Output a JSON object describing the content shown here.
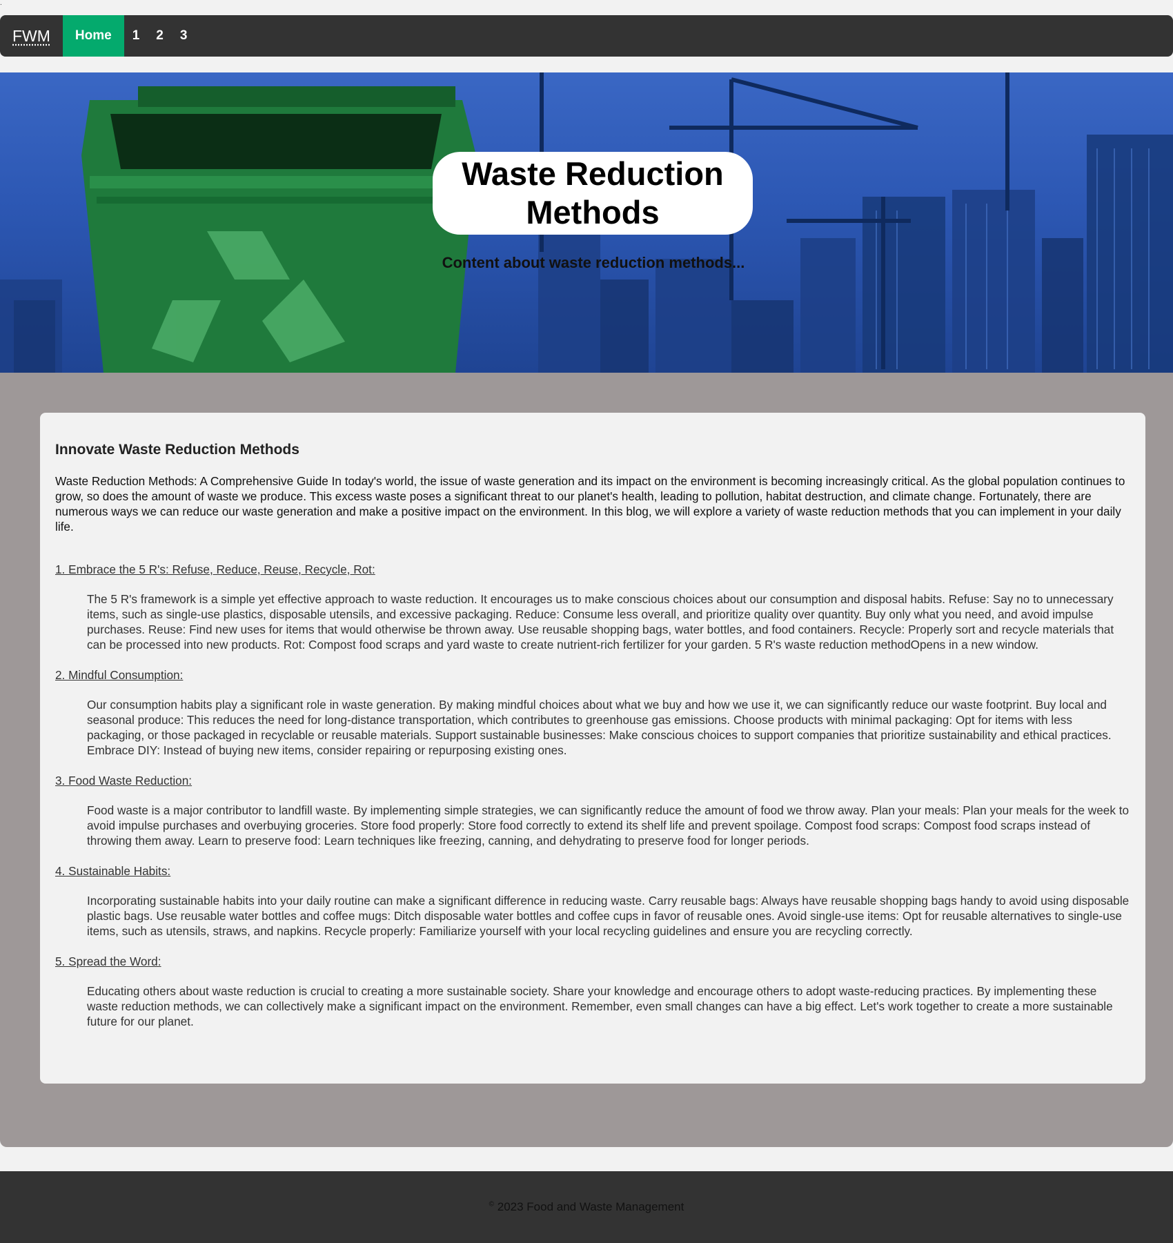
{
  "nav": {
    "brand": "FWM",
    "items": [
      "Home",
      "1",
      "2",
      "3"
    ]
  },
  "hero": {
    "title_line1": "Waste Reduction",
    "title_line2": "Methods",
    "subtitle": "Content about waste reduction methods..."
  },
  "article": {
    "heading": "Innovate Waste Reduction Methods",
    "intro": "Waste Reduction Methods: A Comprehensive Guide In today's world, the issue of waste generation and its impact on the environment is becoming increasingly critical. As the global population continues to grow, so does the amount of waste we produce. This excess waste poses a significant threat to our planet's health, leading to pollution, habitat destruction, and climate change. Fortunately, there are numerous ways we can reduce our waste generation and make a positive impact on the environment. In this blog, we will explore a variety of waste reduction methods that you can implement in your daily life.",
    "sections": [
      {
        "title": "1. Embrace the 5 R's: Refuse, Reduce, Reuse, Recycle, Rot:",
        "body": "The 5 R's framework is a simple yet effective approach to waste reduction. It encourages us to make conscious choices about our consumption and disposal habits. Refuse: Say no to unnecessary items, such as single-use plastics, disposable utensils, and excessive packaging. Reduce: Consume less overall, and prioritize quality over quantity. Buy only what you need, and avoid impulse purchases. Reuse: Find new uses for items that would otherwise be thrown away. Use reusable shopping bags, water bottles, and food containers. Recycle: Properly sort and recycle materials that can be processed into new products. Rot: Compost food scraps and yard waste to create nutrient-rich fertilizer for your garden. 5 R's waste reduction methodOpens in a new window."
      },
      {
        "title": "2. Mindful Consumption:",
        "body": "Our consumption habits play a significant role in waste generation. By making mindful choices about what we buy and how we use it, we can significantly reduce our waste footprint. Buy local and seasonal produce: This reduces the need for long-distance transportation, which contributes to greenhouse gas emissions. Choose products with minimal packaging: Opt for items with less packaging, or those packaged in recyclable or reusable materials. Support sustainable businesses: Make conscious choices to support companies that prioritize sustainability and ethical practices. Embrace DIY: Instead of buying new items, consider repairing or repurposing existing ones."
      },
      {
        "title": "3. Food Waste Reduction:",
        "body": "Food waste is a major contributor to landfill waste. By implementing simple strategies, we can significantly reduce the amount of food we throw away. Plan your meals: Plan your meals for the week to avoid impulse purchases and overbuying groceries. Store food properly: Store food correctly to extend its shelf life and prevent spoilage. Compost food scraps: Compost food scraps instead of throwing them away. Learn to preserve food: Learn techniques like freezing, canning, and dehydrating to preserve food for longer periods."
      },
      {
        "title": "4. Sustainable Habits:",
        "body": "Incorporating sustainable habits into your daily routine can make a significant difference in reducing waste. Carry reusable bags: Always have reusable shopping bags handy to avoid using disposable plastic bags. Use reusable water bottles and coffee mugs: Ditch disposable water bottles and coffee cups in favor of reusable ones. Avoid single-use items: Opt for reusable alternatives to single-use items, such as utensils, straws, and napkins. Recycle properly: Familiarize yourself with your local recycling guidelines and ensure you are recycling correctly."
      },
      {
        "title": "5. Spread the Word:",
        "body": "Educating others about waste reduction is crucial to creating a more sustainable society. Share your knowledge and encourage others to adopt waste-reducing practices. By implementing these waste reduction methods, we can collectively make a significant impact on the environment. Remember, even small changes can have a big effect. Let's work together to create a more sustainable future for our planet."
      }
    ]
  },
  "footer": {
    "copyright_symbol": "©",
    "text": "2023 Food and Waste Management"
  }
}
